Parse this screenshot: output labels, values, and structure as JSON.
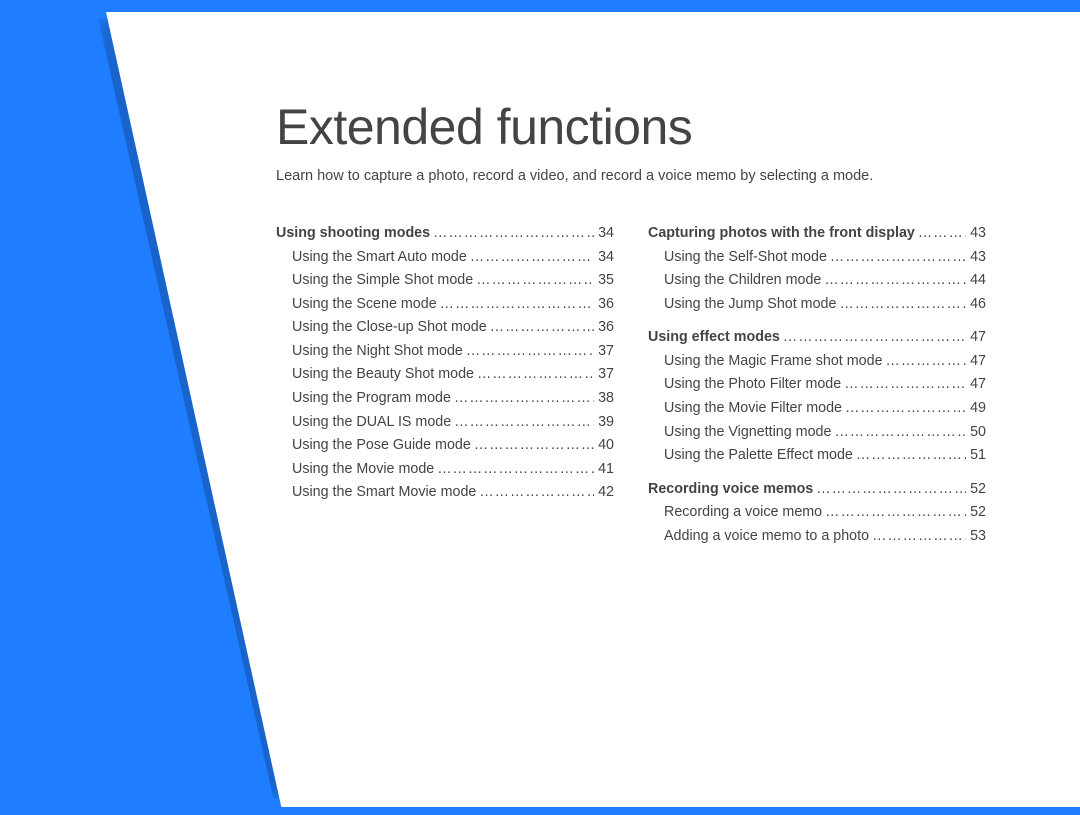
{
  "title": "Extended functions",
  "subtitle": "Learn how to capture a photo, record a video, and record a voice memo by selecting a mode.",
  "columns": [
    [
      {
        "type": "section",
        "label": "Using shooting modes",
        "page": 34
      },
      {
        "type": "sub",
        "label": "Using the Smart Auto mode",
        "page": 34
      },
      {
        "type": "sub",
        "label": "Using the Simple Shot mode",
        "page": 35
      },
      {
        "type": "sub",
        "label": "Using the Scene mode",
        "page": 36
      },
      {
        "type": "sub",
        "label": "Using the Close-up Shot mode",
        "page": 36
      },
      {
        "type": "sub",
        "label": "Using the Night Shot mode",
        "page": 37
      },
      {
        "type": "sub",
        "label": "Using the Beauty Shot mode",
        "page": 37
      },
      {
        "type": "sub",
        "label": "Using the Program mode",
        "page": 38
      },
      {
        "type": "sub",
        "label": "Using the DUAL IS mode",
        "page": 39
      },
      {
        "type": "sub",
        "label": "Using the Pose Guide mode",
        "page": 40
      },
      {
        "type": "sub",
        "label": "Using the Movie mode",
        "page": 41
      },
      {
        "type": "sub",
        "label": "Using the Smart Movie mode",
        "page": 42
      }
    ],
    [
      {
        "type": "section",
        "label": "Capturing photos with the front display",
        "page": 43
      },
      {
        "type": "sub",
        "label": "Using the Self-Shot mode",
        "page": 43
      },
      {
        "type": "sub",
        "label": "Using the Children mode",
        "page": 44
      },
      {
        "type": "sub",
        "label": "Using the Jump Shot mode",
        "page": 46
      },
      {
        "type": "gap"
      },
      {
        "type": "section",
        "label": "Using effect modes",
        "page": 47
      },
      {
        "type": "sub",
        "label": "Using the Magic Frame shot mode",
        "page": 47
      },
      {
        "type": "sub",
        "label": "Using the Photo Filter mode",
        "page": 47
      },
      {
        "type": "sub",
        "label": "Using the Movie Filter mode",
        "page": 49
      },
      {
        "type": "sub",
        "label": "Using the Vignetting mode",
        "page": 50
      },
      {
        "type": "sub",
        "label": "Using the Palette Effect mode",
        "page": 51
      },
      {
        "type": "gap"
      },
      {
        "type": "section",
        "label": "Recording voice memos",
        "page": 52
      },
      {
        "type": "sub",
        "label": "Recording a voice memo",
        "page": 52
      },
      {
        "type": "sub",
        "label": "Adding a voice memo to a photo",
        "page": 53
      }
    ]
  ]
}
